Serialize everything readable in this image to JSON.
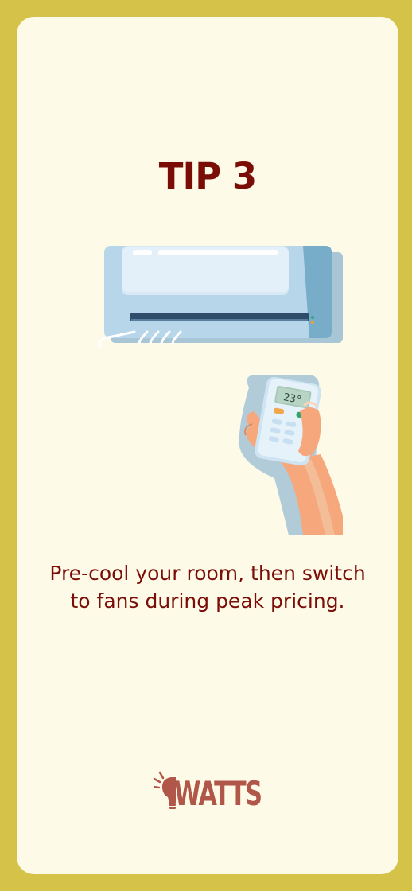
{
  "tip": {
    "title": "TIP 3",
    "text": "Pre-cool your room, then switch to fans during peak pricing."
  },
  "illustration": {
    "remote_display": "23°",
    "icons": [
      "air-conditioner-icon",
      "remote-control-icon",
      "hand-icon"
    ]
  },
  "brand": {
    "name": "WATTS",
    "icon": "lightbulb-icon"
  },
  "colors": {
    "frame": "#d4c249",
    "card": "#fefae8",
    "title": "#7b0d07",
    "logo": "#b0574a"
  }
}
